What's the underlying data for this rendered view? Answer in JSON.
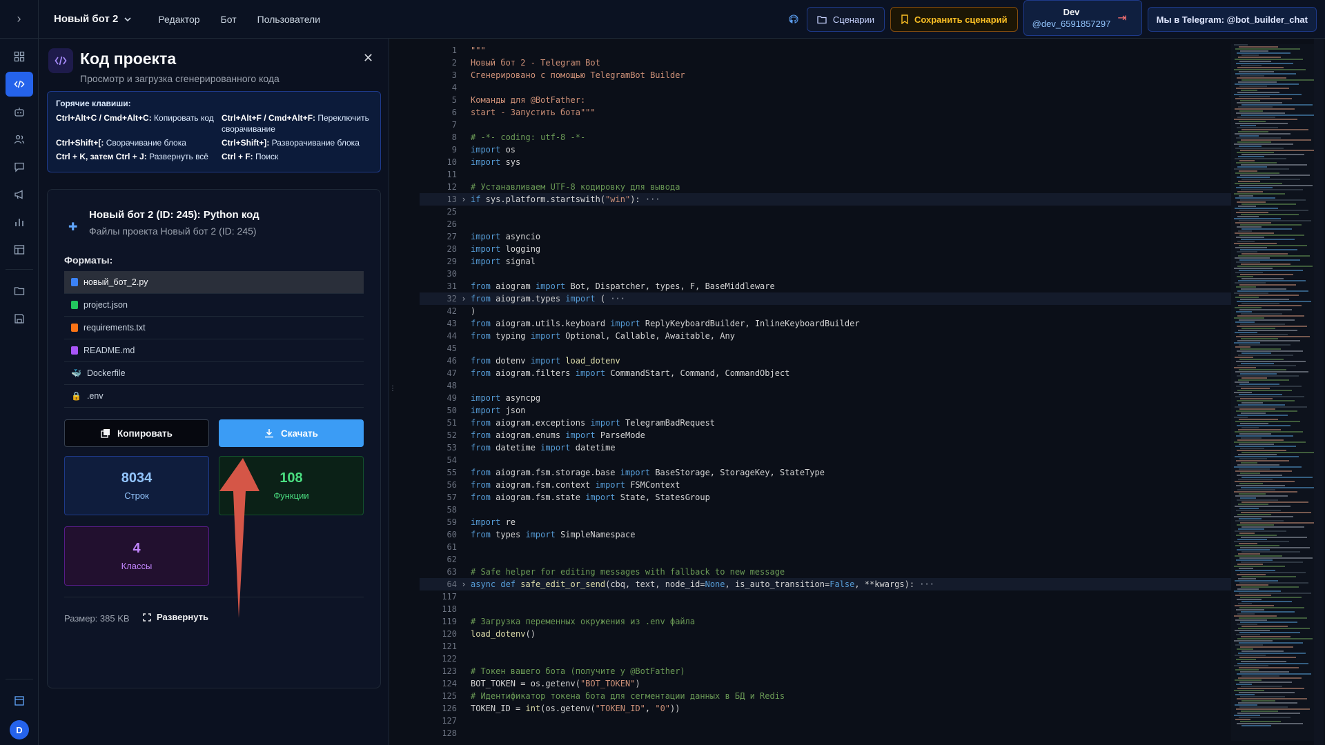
{
  "topbar": {
    "project": "Новый бот 2",
    "nav": [
      "Редактор",
      "Бот",
      "Пользователи"
    ],
    "scenarios_label": "Сценарии",
    "save_label": "Сохранить сценарий",
    "user_name": "Dev",
    "user_handle": "@dev_6591857297",
    "telegram_label": "Мы в Telegram: @bot_builder_chat"
  },
  "rail": {
    "avatar_letter": "D"
  },
  "panel": {
    "title": "Код проекта",
    "subtitle": "Просмотр и загрузка сгенерированного кода",
    "hotkeys_title": "Горячие клавиши:",
    "hotkeys": [
      {
        "keys": "Ctrl+Alt+C / Cmd+Alt+C:",
        "desc": "Копировать код"
      },
      {
        "keys": "Ctrl+Alt+F / Cmd+Alt+F:",
        "desc": "Переключить сворачивание"
      },
      {
        "keys": "Ctrl+Shift+[:",
        "desc": "Сворачивание блока"
      },
      {
        "keys": "Ctrl+Shift+]:",
        "desc": "Разворачивание блока"
      },
      {
        "keys": "Ctrl + K, затем Ctrl + J:",
        "desc": "Развернуть всё"
      },
      {
        "keys": "Ctrl + F:",
        "desc": "Поиск"
      }
    ],
    "card_title": "Новый бот 2 (ID: 245): Python код",
    "card_subtitle": "Файлы проекта Новый бот 2 (ID: 245)",
    "formats_label": "Форматы:",
    "files": [
      {
        "name": "новый_бот_2.py",
        "color": "#3b82f6"
      },
      {
        "name": "project.json",
        "color": "#22c55e"
      },
      {
        "name": "requirements.txt",
        "color": "#f97316"
      },
      {
        "name": "README.md",
        "color": "#a855f7"
      },
      {
        "name": "Dockerfile",
        "color": "#38bdf8"
      },
      {
        "name": ".env",
        "color": "#ef4444"
      }
    ],
    "copy_label": "Копировать",
    "download_label": "Скачать",
    "stats": {
      "lines_value": "8034",
      "lines_label": "Строк",
      "funcs_value": "108",
      "funcs_label": "Функции",
      "classes_value": "4",
      "classes_label": "Классы"
    },
    "size_label": "Размер: 385 KB",
    "expand_label": "Развернуть"
  },
  "editor": {
    "lines": [
      {
        "n": "1",
        "t": "\"\"\"",
        "c": "str"
      },
      {
        "n": "2",
        "t": "Новый бот 2 - Telegram Bot",
        "c": "str"
      },
      {
        "n": "3",
        "t": "Сгенерировано с помощью TelegramBot Builder",
        "c": "str"
      },
      {
        "n": "4",
        "t": "",
        "c": ""
      },
      {
        "n": "5",
        "t": "Команды для @BotFather:",
        "c": "str"
      },
      {
        "n": "6",
        "t": "start - Запустить бота\"\"\"",
        "c": "str"
      },
      {
        "n": "7",
        "t": "",
        "c": ""
      },
      {
        "n": "8",
        "t": "# -*- coding: utf-8 -*-",
        "c": "cm"
      },
      {
        "n": "9",
        "t": "import os",
        "c": "imp"
      },
      {
        "n": "10",
        "t": "import sys",
        "c": "imp"
      },
      {
        "n": "11",
        "t": "",
        "c": ""
      },
      {
        "n": "12",
        "t": "# Устанавливаем UTF-8 кодировку для вывода",
        "c": "cm"
      },
      {
        "n": "13",
        "t": "if sys.platform.startswith(\"win\"): ···",
        "c": "fold"
      },
      {
        "n": "25",
        "t": "",
        "c": ""
      },
      {
        "n": "26",
        "t": "",
        "c": ""
      },
      {
        "n": "27",
        "t": "import asyncio",
        "c": "imp"
      },
      {
        "n": "28",
        "t": "import logging",
        "c": "imp"
      },
      {
        "n": "29",
        "t": "import signal",
        "c": "imp"
      },
      {
        "n": "30",
        "t": "",
        "c": ""
      },
      {
        "n": "31",
        "t": "from aiogram import Bot, Dispatcher, types, F, BaseMiddleware",
        "c": "from"
      },
      {
        "n": "32",
        "t": "from aiogram.types import ( ···",
        "c": "foldfrom"
      },
      {
        "n": "42",
        "t": ")",
        "c": ""
      },
      {
        "n": "43",
        "t": "from aiogram.utils.keyboard import ReplyKeyboardBuilder, InlineKeyboardBuilder",
        "c": "from"
      },
      {
        "n": "44",
        "t": "from typing import Optional, Callable, Awaitable, Any",
        "c": "from"
      },
      {
        "n": "45",
        "t": "",
        "c": ""
      },
      {
        "n": "46",
        "t": "from dotenv import load_dotenv",
        "c": "from"
      },
      {
        "n": "47",
        "t": "from aiogram.filters import CommandStart, Command, CommandObject",
        "c": "from"
      },
      {
        "n": "48",
        "t": "",
        "c": ""
      },
      {
        "n": "49",
        "t": "import asyncpg",
        "c": "imp"
      },
      {
        "n": "50",
        "t": "import json",
        "c": "imp"
      },
      {
        "n": "51",
        "t": "from aiogram.exceptions import TelegramBadRequest",
        "c": "from"
      },
      {
        "n": "52",
        "t": "from aiogram.enums import ParseMode",
        "c": "from"
      },
      {
        "n": "53",
        "t": "from datetime import datetime",
        "c": "from"
      },
      {
        "n": "54",
        "t": "",
        "c": ""
      },
      {
        "n": "55",
        "t": "from aiogram.fsm.storage.base import BaseStorage, StorageKey, StateType",
        "c": "from"
      },
      {
        "n": "56",
        "t": "from aiogram.fsm.context import FSMContext",
        "c": "from"
      },
      {
        "n": "57",
        "t": "from aiogram.fsm.state import State, StatesGroup",
        "c": "from"
      },
      {
        "n": "58",
        "t": "",
        "c": ""
      },
      {
        "n": "59",
        "t": "import re",
        "c": "imp"
      },
      {
        "n": "60",
        "t": "from types import SimpleNamespace",
        "c": "from"
      },
      {
        "n": "61",
        "t": "",
        "c": ""
      },
      {
        "n": "62",
        "t": "",
        "c": ""
      },
      {
        "n": "63",
        "t": "# Safe helper for editing messages with fallback to new message",
        "c": "cm"
      },
      {
        "n": "64",
        "t": "async def safe_edit_or_send(cbq, text, node_id=None, is_auto_transition=False, **kwargs): ···",
        "c": "folddef"
      },
      {
        "n": "117",
        "t": "",
        "c": ""
      },
      {
        "n": "118",
        "t": "",
        "c": ""
      },
      {
        "n": "119",
        "t": "# Загрузка переменных окружения из .env файла",
        "c": "cm"
      },
      {
        "n": "120",
        "t": "load_dotenv()",
        "c": "call"
      },
      {
        "n": "121",
        "t": "",
        "c": ""
      },
      {
        "n": "122",
        "t": "",
        "c": ""
      },
      {
        "n": "123",
        "t": "# Токен вашего бота (получите у @BotFather)",
        "c": "cm"
      },
      {
        "n": "124",
        "t": "BOT_TOKEN = os.getenv(\"BOT_TOKEN\")",
        "c": "assign"
      },
      {
        "n": "125",
        "t": "# Идентификатор токена бота для сегментации данных в БД и Redis",
        "c": "cm"
      },
      {
        "n": "126",
        "t": "TOKEN_ID = int(os.getenv(\"TOKEN_ID\", \"0\"))",
        "c": "assign"
      },
      {
        "n": "127",
        "t": "",
        "c": ""
      },
      {
        "n": "128",
        "t": "",
        "c": ""
      }
    ]
  }
}
